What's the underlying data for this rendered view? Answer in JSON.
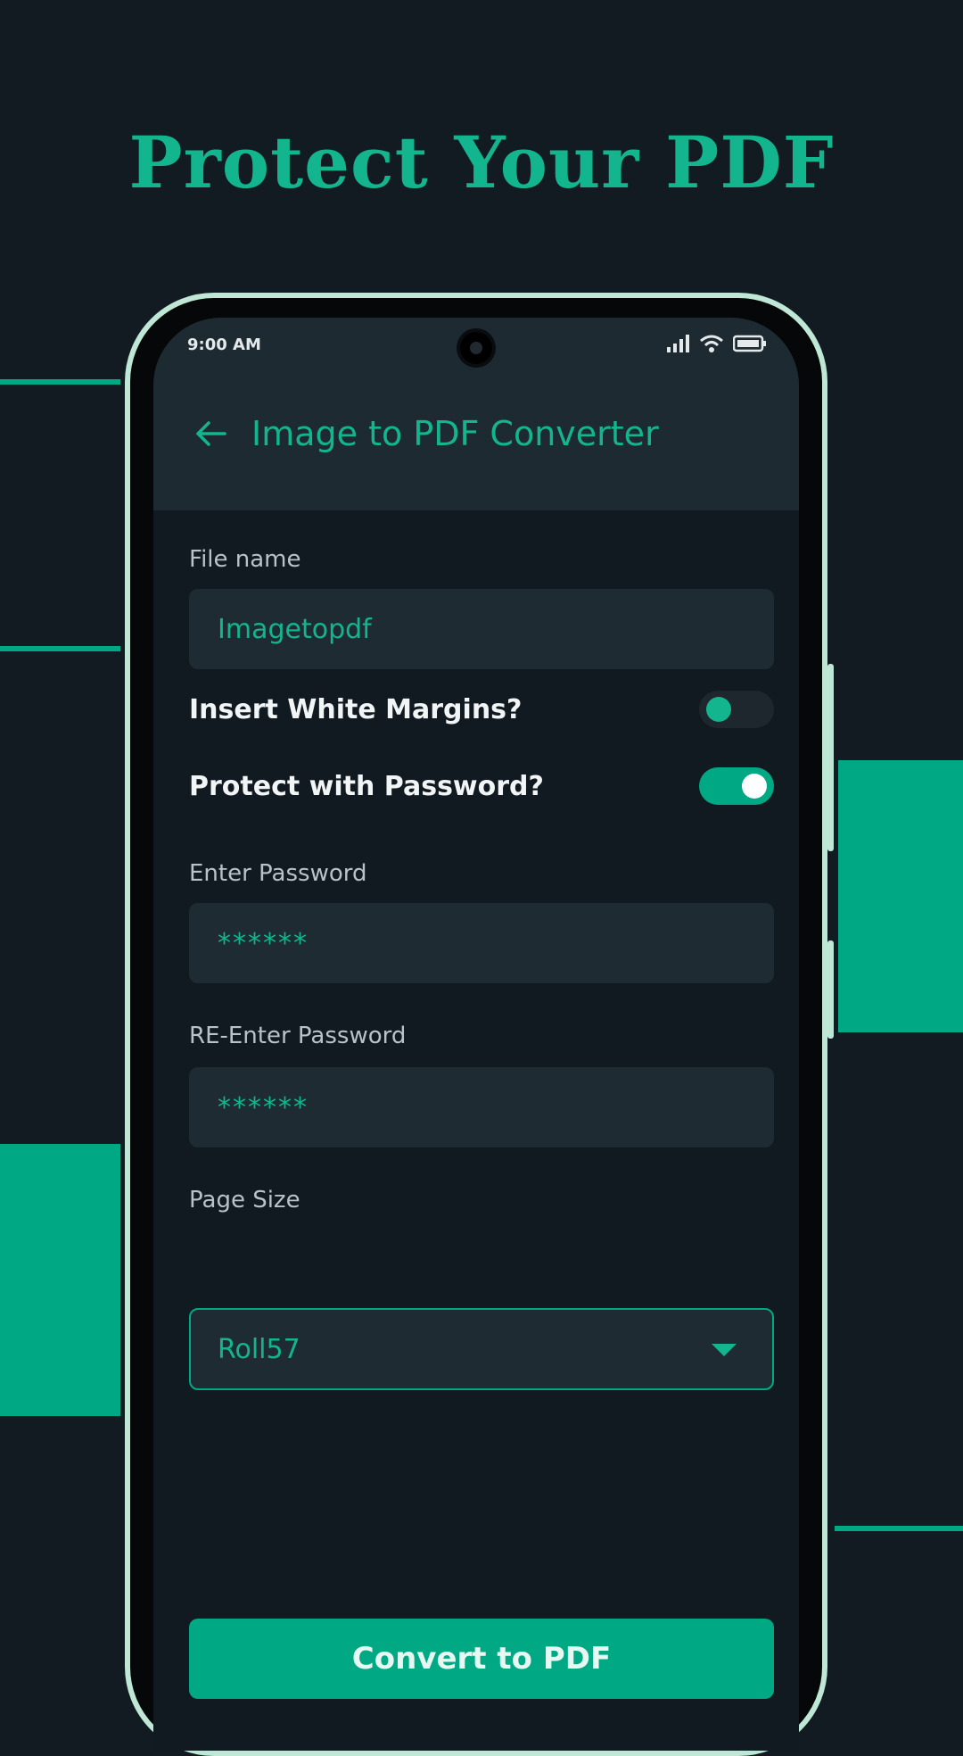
{
  "promo": {
    "title": "Protect Your PDF"
  },
  "status_bar": {
    "time": "9:00 AM",
    "icons": [
      "signal-icon",
      "wifi-icon",
      "battery-icon"
    ]
  },
  "app_bar": {
    "back_icon": "back-arrow-icon",
    "title": "Image to PDF Converter"
  },
  "form": {
    "file_name": {
      "label": "File name",
      "value": "Imagetopdf"
    },
    "white_margins": {
      "label": "Insert White Margins?",
      "enabled": false
    },
    "password_protect": {
      "label": "Protect with Password?",
      "enabled": true
    },
    "password": {
      "label": "Enter Password",
      "value": "******"
    },
    "confirm_password": {
      "label": "RE-Enter Password",
      "value": "******"
    },
    "page_size": {
      "label": "Page Size",
      "selected": "Roll57"
    }
  },
  "actions": {
    "convert_label": "Convert to PDF"
  },
  "colors": {
    "accent": "#00a884",
    "accent_text": "#13b58e",
    "background": "#131b22",
    "surface": "#1f2b33"
  }
}
